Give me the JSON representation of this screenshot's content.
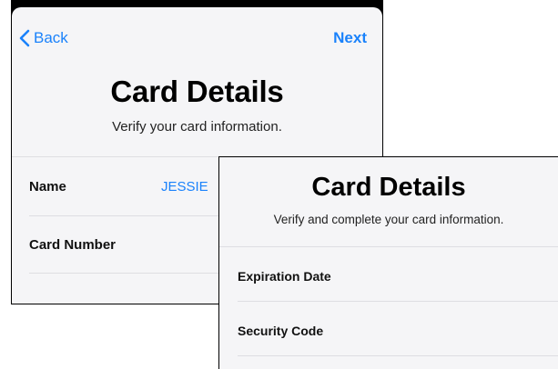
{
  "back_screen": {
    "nav": {
      "back_label": "Back",
      "next_label": "Next"
    },
    "title": "Card Details",
    "subtitle": "Verify your card information.",
    "rows": [
      {
        "label": "Name",
        "value": "JESSIE"
      },
      {
        "label": "Card Number",
        "value": ""
      }
    ]
  },
  "front_screen": {
    "title": "Card Details",
    "subtitle": "Verify and complete your card information.",
    "rows": [
      {
        "label": "Expiration Date"
      },
      {
        "label": "Security Code"
      }
    ]
  },
  "colors": {
    "accent": "#1a82fb",
    "background": "#f5f5f7",
    "separator": "#dedee2"
  },
  "icons": {
    "back": "chevron-left-icon"
  }
}
